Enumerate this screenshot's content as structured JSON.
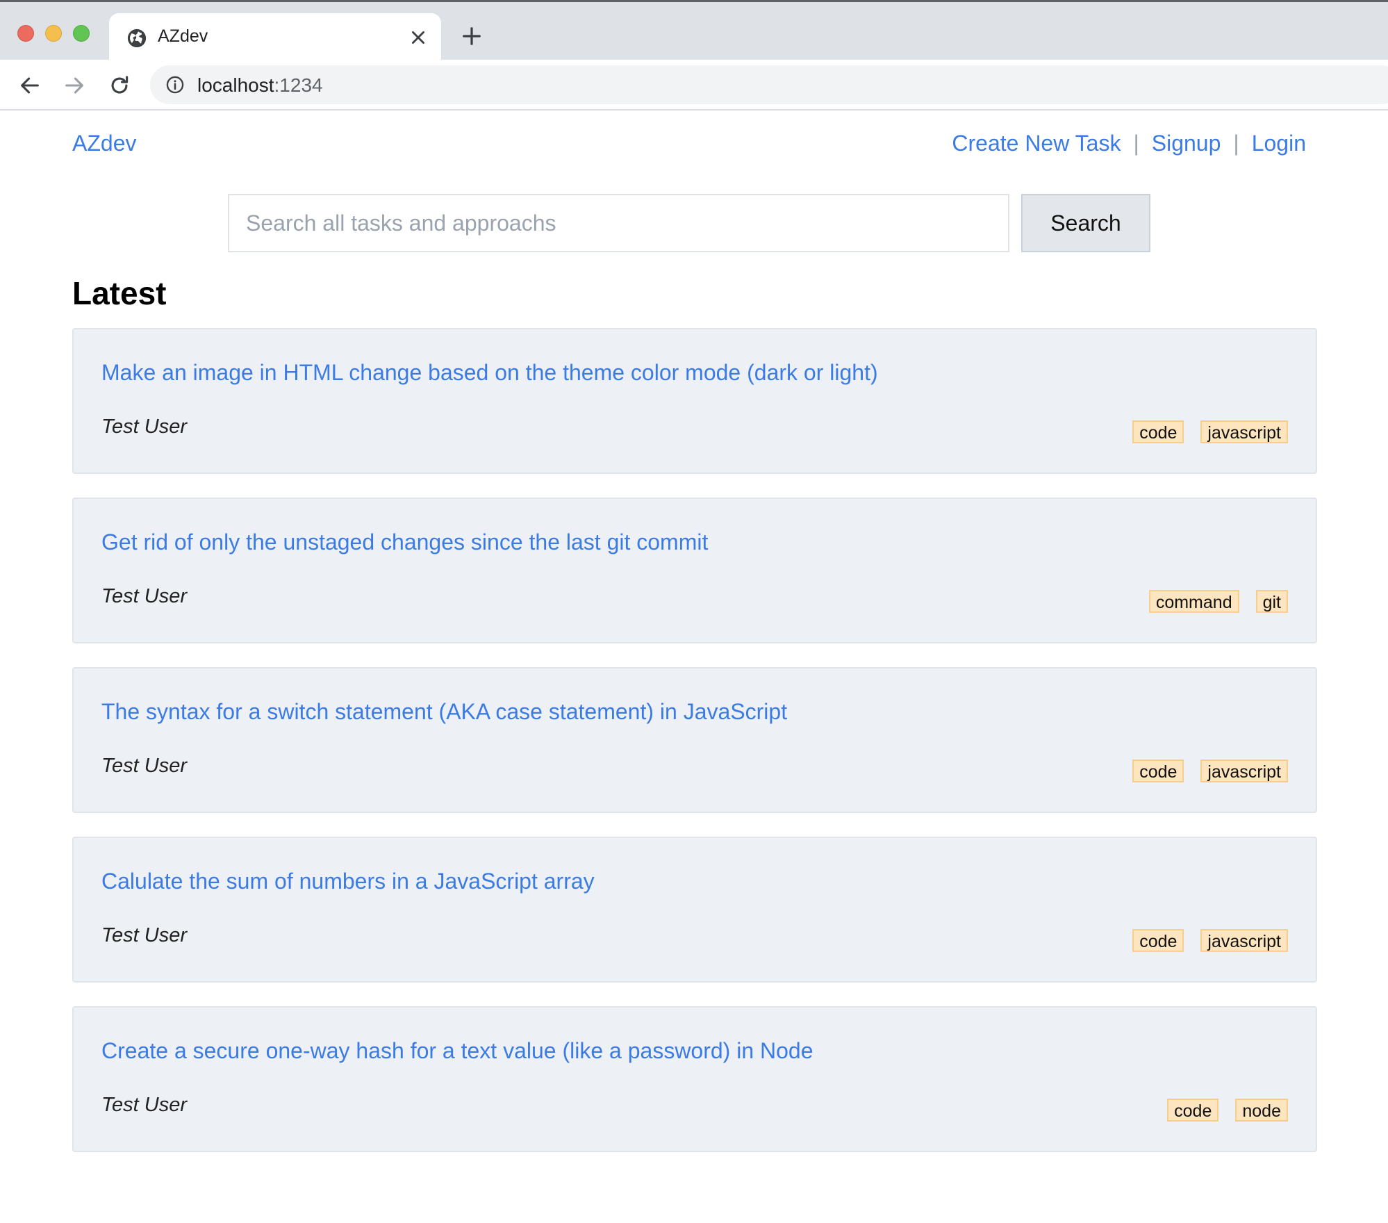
{
  "browser": {
    "tab_title": "AZdev",
    "url_host": "localhost",
    "url_port": ":1234"
  },
  "header": {
    "brand": "AZdev",
    "nav": {
      "create": "Create New Task",
      "signup": "Signup",
      "login": "Login",
      "separator": "|"
    }
  },
  "search": {
    "placeholder": "Search all tasks and approachs",
    "button_label": "Search"
  },
  "latest": {
    "heading": "Latest",
    "tasks": [
      {
        "title": "Make an image in HTML change based on the theme color mode (dark or light)",
        "author": "Test User",
        "tags": [
          "code",
          "javascript"
        ]
      },
      {
        "title": "Get rid of only the unstaged changes since the last git commit",
        "author": "Test User",
        "tags": [
          "command",
          "git"
        ]
      },
      {
        "title": "The syntax for a switch statement (AKA case statement) in JavaScript",
        "author": "Test User",
        "tags": [
          "code",
          "javascript"
        ]
      },
      {
        "title": "Calulate the sum of numbers in a JavaScript array",
        "author": "Test User",
        "tags": [
          "code",
          "javascript"
        ]
      },
      {
        "title": "Create a secure one-way hash for a text value (like a password) in Node",
        "author": "Test User",
        "tags": [
          "code",
          "node"
        ]
      }
    ]
  },
  "icons": {
    "tab": "globe-icon",
    "close": "close-icon",
    "new_tab": "plus-icon",
    "back": "arrow-left-icon",
    "forward": "arrow-right-icon",
    "reload": "reload-icon",
    "site_info": "info-icon"
  },
  "colors": {
    "link": "#3b7be4",
    "card_bg": "#edf0f5",
    "tag_bg": "#fde6bf",
    "tag_border": "#f7cf8d"
  }
}
